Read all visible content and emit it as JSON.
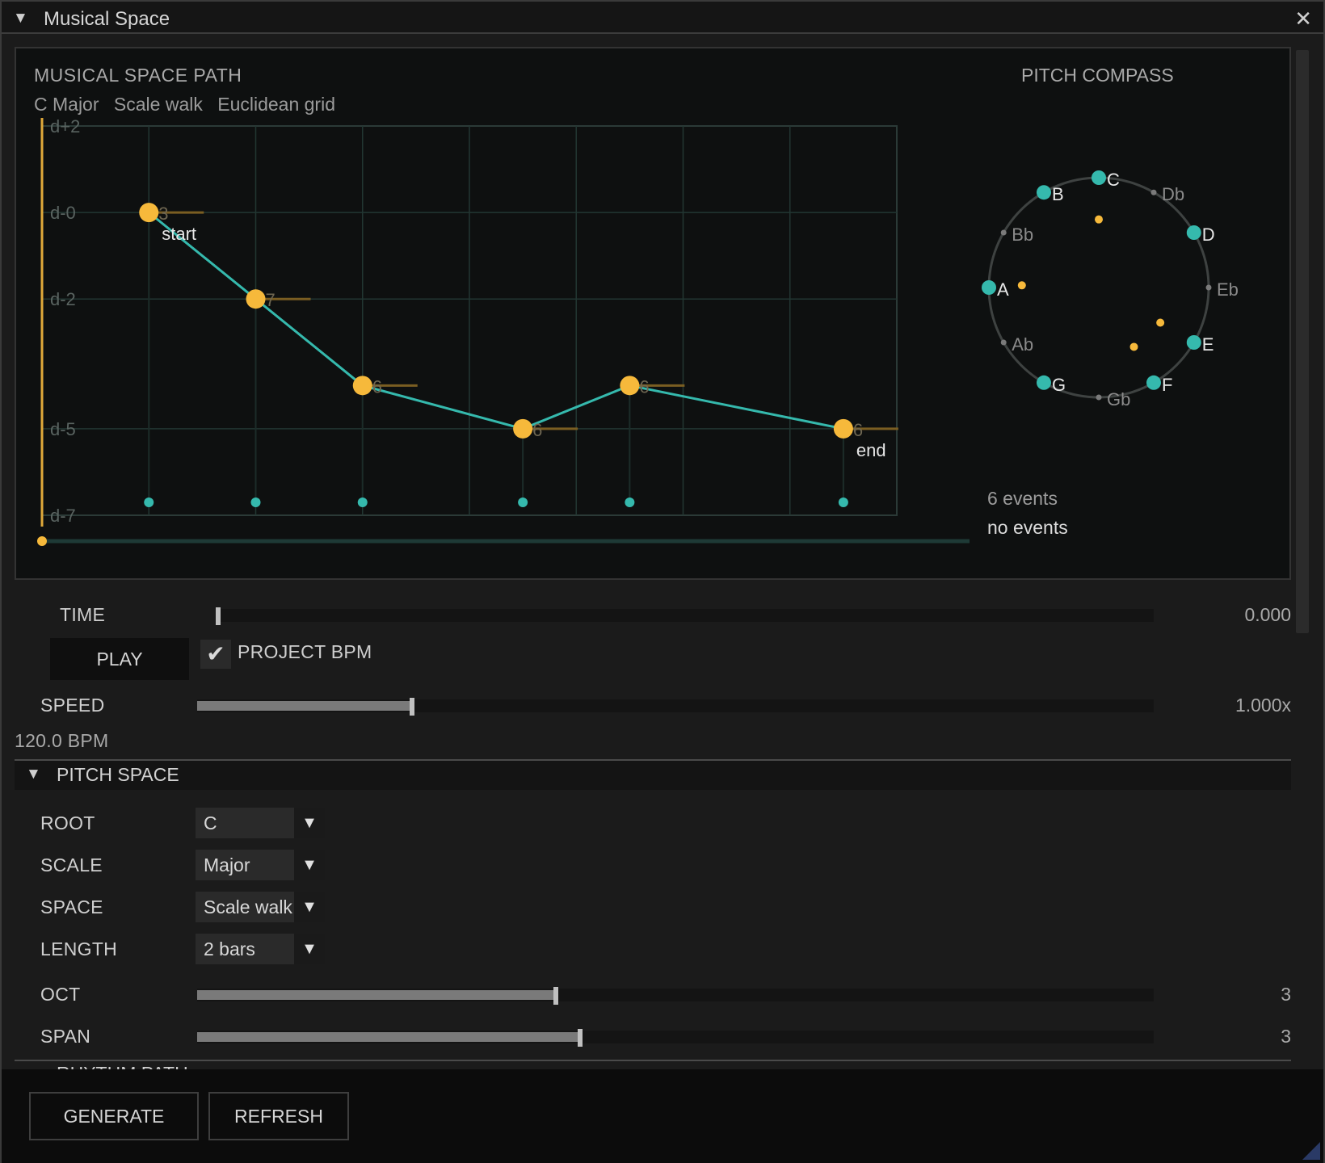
{
  "window": {
    "title": "Musical Space",
    "collapse_icon": "▼",
    "close_icon": "✕"
  },
  "path_view": {
    "title": "MUSICAL SPACE PATH",
    "subtitle": [
      "C Major",
      "Scale walk",
      "Euclidean grid"
    ],
    "y_axis": [
      "d+2",
      "d-0",
      "d-2",
      "d-5",
      "d-7"
    ],
    "points": [
      {
        "step": 1,
        "degree": 0,
        "label": "3",
        "tag": "start"
      },
      {
        "step": 2,
        "degree": -2,
        "label": "7",
        "tag": ""
      },
      {
        "step": 3,
        "degree": -4,
        "label": "6",
        "tag": ""
      },
      {
        "step": 4.5,
        "degree": -5,
        "label": "6",
        "tag": ""
      },
      {
        "step": 5.5,
        "degree": -4,
        "label": "6",
        "tag": ""
      },
      {
        "step": 7.5,
        "degree": -5,
        "label": "6",
        "tag": "end"
      }
    ],
    "colors": {
      "path": "#35b9ad",
      "note": "#f6b93b",
      "grid": "#223632",
      "playhead": "#e0a93a"
    }
  },
  "compass": {
    "title": "PITCH COMPASS",
    "notes": [
      {
        "name": "C",
        "in_scale": true
      },
      {
        "name": "Db",
        "in_scale": false
      },
      {
        "name": "D",
        "in_scale": true
      },
      {
        "name": "Eb",
        "in_scale": false
      },
      {
        "name": "E",
        "in_scale": true
      },
      {
        "name": "F",
        "in_scale": true
      },
      {
        "name": "Gb",
        "in_scale": false
      },
      {
        "name": "G",
        "in_scale": true
      },
      {
        "name": "Ab",
        "in_scale": false
      },
      {
        "name": "A",
        "in_scale": true
      },
      {
        "name": "Bb",
        "in_scale": false
      },
      {
        "name": "B",
        "in_scale": true
      }
    ],
    "events_count": "6 events",
    "events_status": "no events"
  },
  "transport": {
    "time_label": "TIME",
    "time_value": "0.000",
    "time_fraction": 0.0,
    "play_label": "PLAY",
    "project_bpm_label": "PROJECT BPM",
    "project_bpm_checked": true,
    "check_icon": "✔",
    "speed_label": "SPEED",
    "speed_value": "1.000x",
    "speed_fraction": 0.225,
    "bpm_text": "120.0 BPM"
  },
  "pitch_space": {
    "header": "PITCH SPACE",
    "collapse_icon": "▼",
    "root_label": "ROOT",
    "root_value": "C",
    "scale_label": "SCALE",
    "scale_value": "Major",
    "space_label": "SPACE",
    "space_value": "Scale walk",
    "length_label": "LENGTH",
    "length_value": "2 bars",
    "dropdown_arrow": "▼",
    "oct_label": "OCT",
    "oct_value": "3",
    "oct_fraction": 0.375,
    "span_label": "SPAN",
    "span_value": "3",
    "span_fraction": 0.4
  },
  "next_section": {
    "header": "RHYTHM PATH"
  },
  "footer": {
    "generate_label": "GENERATE",
    "refresh_label": "REFRESH"
  }
}
